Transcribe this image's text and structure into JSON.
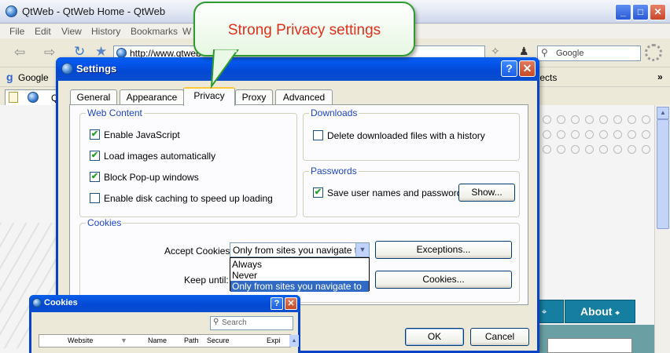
{
  "browser": {
    "title": "QtWeb - QtWeb Home - QtWeb",
    "window_buttons": [
      "minimize",
      "maximize",
      "close"
    ],
    "menu": [
      "File",
      "Edit",
      "View",
      "History",
      "Bookmarks",
      "W"
    ],
    "address": "http://www.qtweb",
    "search_placeholder": "Google",
    "bookmarks": {
      "google": "Google",
      "projects": "ojects",
      "more": "»"
    },
    "tab_label": "Q",
    "about_label": "About",
    "accent_color": "#167ea1"
  },
  "callout": {
    "text": "Strong Privacy settings",
    "text_color": "#e22f1b",
    "border_color": "#2d9b2d"
  },
  "settings": {
    "title": "Settings",
    "help": "?",
    "close": "✕",
    "tabs": [
      {
        "label": "General",
        "active": false
      },
      {
        "label": "Appearance",
        "active": false
      },
      {
        "label": "Privacy",
        "active": true
      },
      {
        "label": "Proxy",
        "active": false
      },
      {
        "label": "Advanced",
        "active": false
      }
    ],
    "web_content": {
      "title": "Web Content",
      "options": [
        {
          "label": "Enable JavaScript",
          "checked": true
        },
        {
          "label": "Load images automatically",
          "checked": true
        },
        {
          "label": "Block Pop-up windows",
          "checked": true
        },
        {
          "label": "Enable disk caching to speed up loading",
          "checked": false
        }
      ]
    },
    "downloads": {
      "title": "Downloads",
      "option": {
        "label": "Delete downloaded files with a history",
        "checked": false
      }
    },
    "passwords": {
      "title": "Passwords",
      "option": {
        "label": "Save user names and passwords",
        "checked": true
      },
      "button": "Show..."
    },
    "cookies": {
      "title": "Cookies",
      "accept_label": "Accept Cookies:",
      "accept_value": "Only from sites you navigate to",
      "accept_options": [
        "Always",
        "Never",
        "Only from sites you navigate to"
      ],
      "selected_index": 2,
      "exceptions_button": "Exceptions...",
      "keep_label": "Keep until:",
      "cookies_button": "Cookies..."
    },
    "ok": "OK",
    "cancel": "Cancel"
  },
  "cookies_dialog": {
    "title": "Cookies",
    "help": "?",
    "close": "✕",
    "search_placeholder": "Search",
    "columns": [
      "Website",
      "Name",
      "Path",
      "Secure",
      "Expi"
    ]
  }
}
